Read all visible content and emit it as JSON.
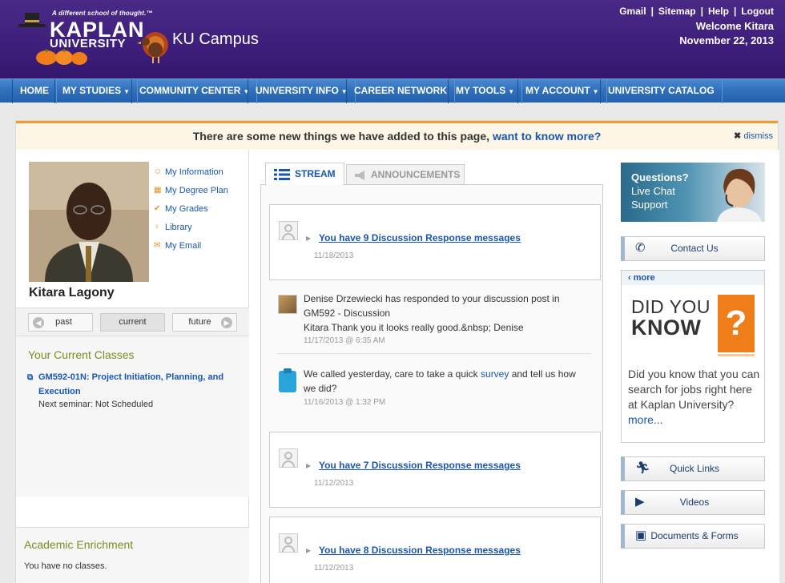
{
  "header": {
    "tagline": "A different school of thought.™",
    "logo_line1": "KAPLAN",
    "logo_line2": "UNIVERSITY",
    "campus": "KU Campus",
    "links": [
      "Gmail",
      "Sitemap",
      "Help",
      "Logout"
    ],
    "welcome": "Welcome Kitara",
    "date": "November 22, 2013"
  },
  "nav": {
    "items": [
      {
        "label": "HOME",
        "dropdown": false
      },
      {
        "label": "MY STUDIES",
        "dropdown": true
      },
      {
        "label": "COMMUNITY CENTER",
        "dropdown": true
      },
      {
        "label": "UNIVERSITY INFO",
        "dropdown": true
      },
      {
        "label": "CAREER NETWORK",
        "dropdown": false
      },
      {
        "label": "MY TOOLS",
        "dropdown": true
      },
      {
        "label": "MY ACCOUNT",
        "dropdown": true
      },
      {
        "label": "UNIVERSITY CATALOG",
        "dropdown": false
      }
    ]
  },
  "notice": {
    "text": "There are some new things we have added to this page,",
    "link": "want to know more?",
    "dismiss": "dismiss"
  },
  "profile": {
    "name": "Kitara Lagony",
    "links": [
      {
        "label": "My Information",
        "icon": "user-icon"
      },
      {
        "label": "My Degree Plan",
        "icon": "grid-icon"
      },
      {
        "label": "My Grades",
        "icon": "check-icon"
      },
      {
        "label": "Library",
        "icon": "bulb-icon"
      },
      {
        "label": "My Email",
        "icon": "mail-icon"
      }
    ]
  },
  "class_tabs": {
    "past": "past",
    "current": "current",
    "future": "future"
  },
  "current_classes": {
    "title": "Your Current Classes",
    "course": "GM592-01N: Project Initiation, Planning, and Execution",
    "next_seminar": "Next seminar: Not Scheduled"
  },
  "academic_enrichment": {
    "title": "Academic Enrichment",
    "text": "You have no classes."
  },
  "stream": {
    "tab_stream": "STREAM",
    "tab_announcements": "ANNOUNCEMENTS",
    "items": [
      {
        "type": "discussion",
        "text": "You have 9 Discussion Response messages",
        "date": "11/18/2013"
      },
      {
        "type": "post",
        "text1": "Denise Drzewiecki has responded to your discussion post in",
        "text2": "GM592 - Discussion",
        "text3": "Kitara Thank you it looks really good.&nbsp; Denise",
        "date": "11/17/2013 @ 6:35 AM"
      },
      {
        "type": "survey",
        "text1": "We called yesterday, care to take a quick",
        "link": "survey",
        "text1b": "and tell us how",
        "text2": "we did?",
        "date": "11/16/2013 @ 1:32 PM"
      },
      {
        "type": "discussion",
        "text": "You have 7 Discussion Response messages",
        "date": "11/12/2013"
      },
      {
        "type": "discussion",
        "text": "You have 8 Discussion Response messages",
        "date": "11/12/2013"
      }
    ]
  },
  "right": {
    "livechat": {
      "line1": "Questions?",
      "line2": "Live Chat",
      "line3": "Support"
    },
    "contact": "Contact Us",
    "dyk": {
      "more": "‹ more",
      "title1": "DID YOU",
      "title2": "KNOW",
      "q": "?",
      "body": "Did you know that you can search for jobs right here at Kaplan University?",
      "more_link": "more..."
    },
    "quick_links": "Quick Links",
    "videos": "Videos",
    "documents": "Documents & Forms"
  },
  "colors": {
    "brand_purple": "#3f1f7c",
    "nav_blue": "#2f6fbb",
    "notice_orange": "#f29a2e",
    "link_blue": "#1a56b0",
    "olive": "#7a8c1e",
    "dyk_orange": "#ef7d1a"
  }
}
